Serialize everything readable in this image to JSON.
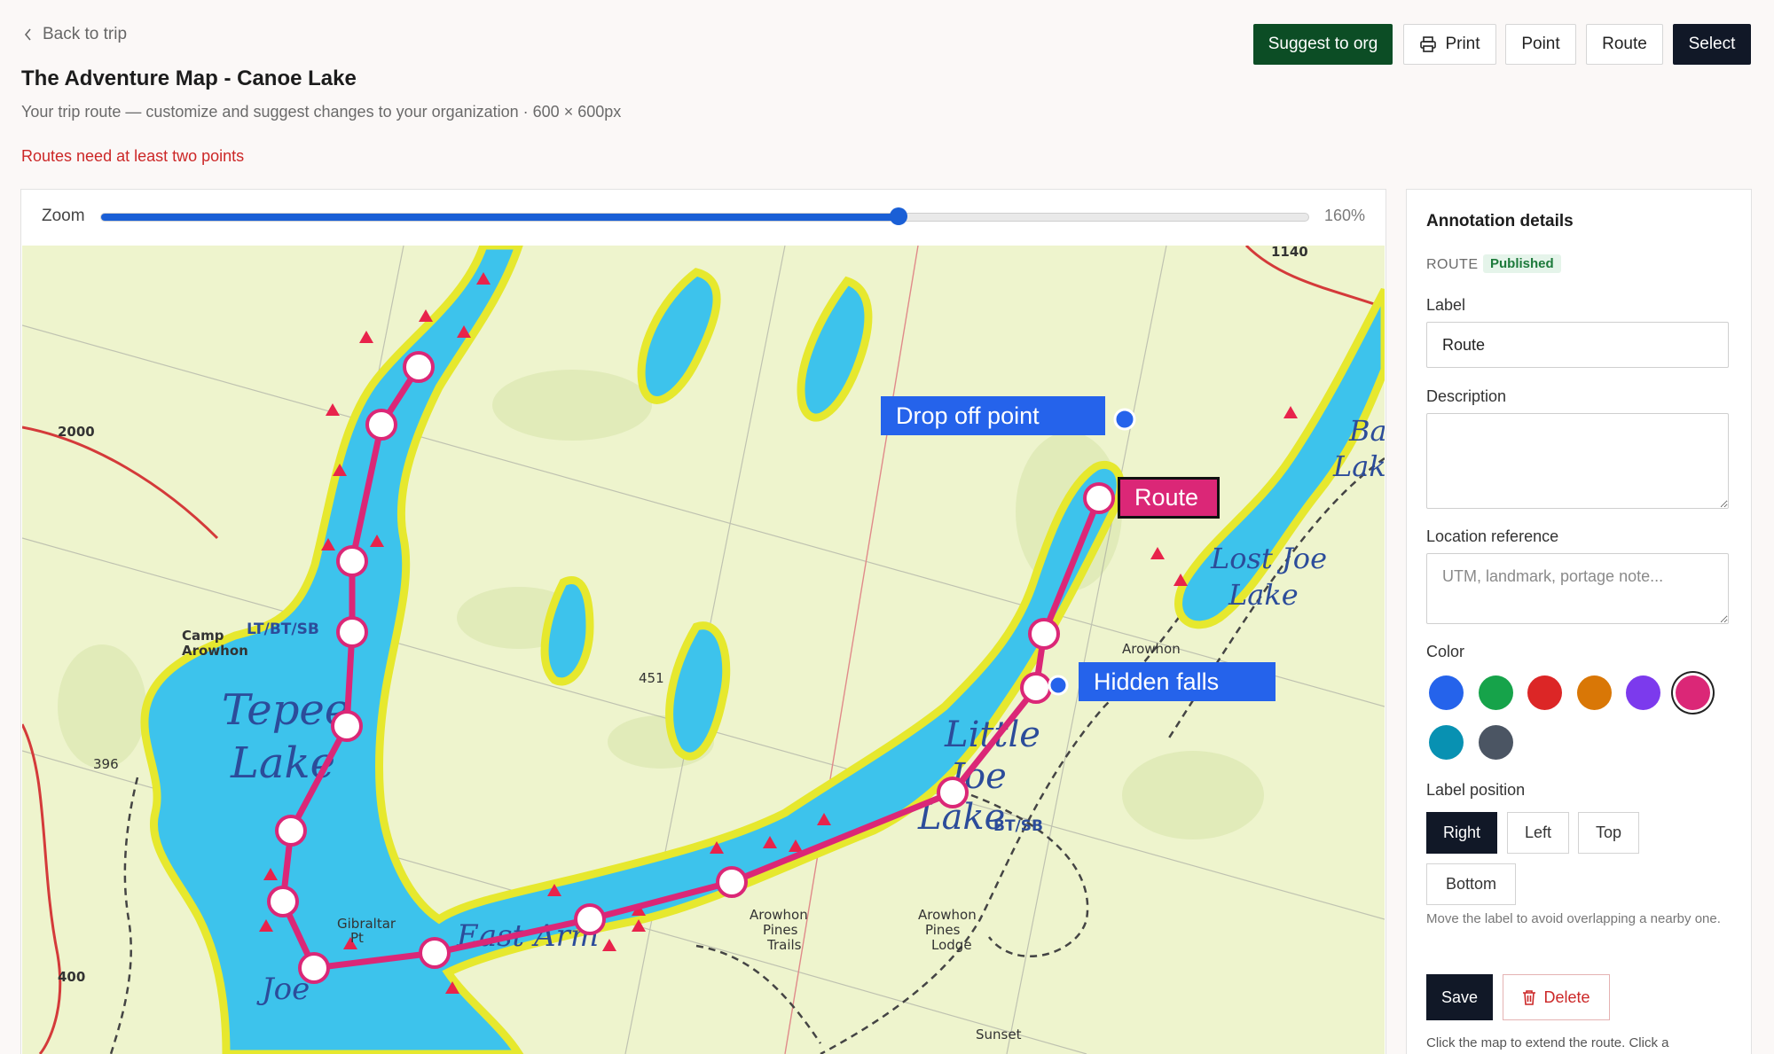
{
  "nav": {
    "back_label": "Back to trip"
  },
  "page": {
    "title": "The Adventure Map - Canoe Lake",
    "subtitle": "Your trip route — customize and suggest changes to your organization · 600 × 600px",
    "error": "Routes need at least two points"
  },
  "toolbar": {
    "suggest_label": "Suggest to org",
    "print_label": "Print",
    "point_label": "Point",
    "route_label": "Route",
    "select_label": "Select"
  },
  "zoom": {
    "label": "Zoom",
    "value_text": "160%",
    "fraction": 0.66
  },
  "map": {
    "annotations": [
      {
        "label": "Drop off point",
        "type": "point",
        "color": "#2563eb"
      },
      {
        "label": "Route",
        "type": "route",
        "color": "#db2777"
      },
      {
        "label": "Hidden falls",
        "type": "point",
        "color": "#2563eb"
      }
    ],
    "map_text": {
      "tepee": "Tepee",
      "tepee_lake": "Lake",
      "camp": "Camp",
      "arowhon": "Arowhon",
      "little": "Little",
      "joe": "Joe",
      "lake2": "Lake",
      "lost_joe": "Lost Joe",
      "lake3": "Lake",
      "east_arm": "East Arm",
      "ba": "Ba",
      "lak": "Lak",
      "joe2": "Joe",
      "ltbtsb": "LT/BT/SB",
      "btsb": "BT/SB",
      "n2000": "2000",
      "n1140": "1140",
      "n451": "451",
      "n396": "396",
      "n400": "400",
      "arowhon_pines": "Arowhon",
      "pines": "Pines",
      "trails": "Trails",
      "arowhon_lodge": "Arowhon",
      "pines_lodge": "Pines",
      "lodge": "Lodge",
      "gibraltar": "Gibraltar",
      "pt": "Pt",
      "sunset": "Sunset",
      "arowhon2": "Arowhon"
    }
  },
  "panel": {
    "title": "Annotation details",
    "kind": "ROUTE",
    "status": "Published",
    "label_label": "Label",
    "label_value": "Route",
    "description_label": "Description",
    "description_value": "",
    "location_label": "Location reference",
    "location_placeholder": "UTM, landmark, portage note...",
    "color_label": "Color",
    "colors": [
      "#2563eb",
      "#16a34a",
      "#dc2626",
      "#d97706",
      "#7c3aed",
      "#db2777",
      "#0891b2",
      "#4b5563"
    ],
    "selected_color": "#db2777",
    "position_label": "Label position",
    "positions": [
      "Right",
      "Left",
      "Top",
      "Bottom"
    ],
    "selected_position": "Right",
    "position_hint": "Move the label to avoid overlapping a nearby one.",
    "save_label": "Save",
    "delete_label": "Delete",
    "footer_hint": "Click the map to extend the route. Click a"
  }
}
